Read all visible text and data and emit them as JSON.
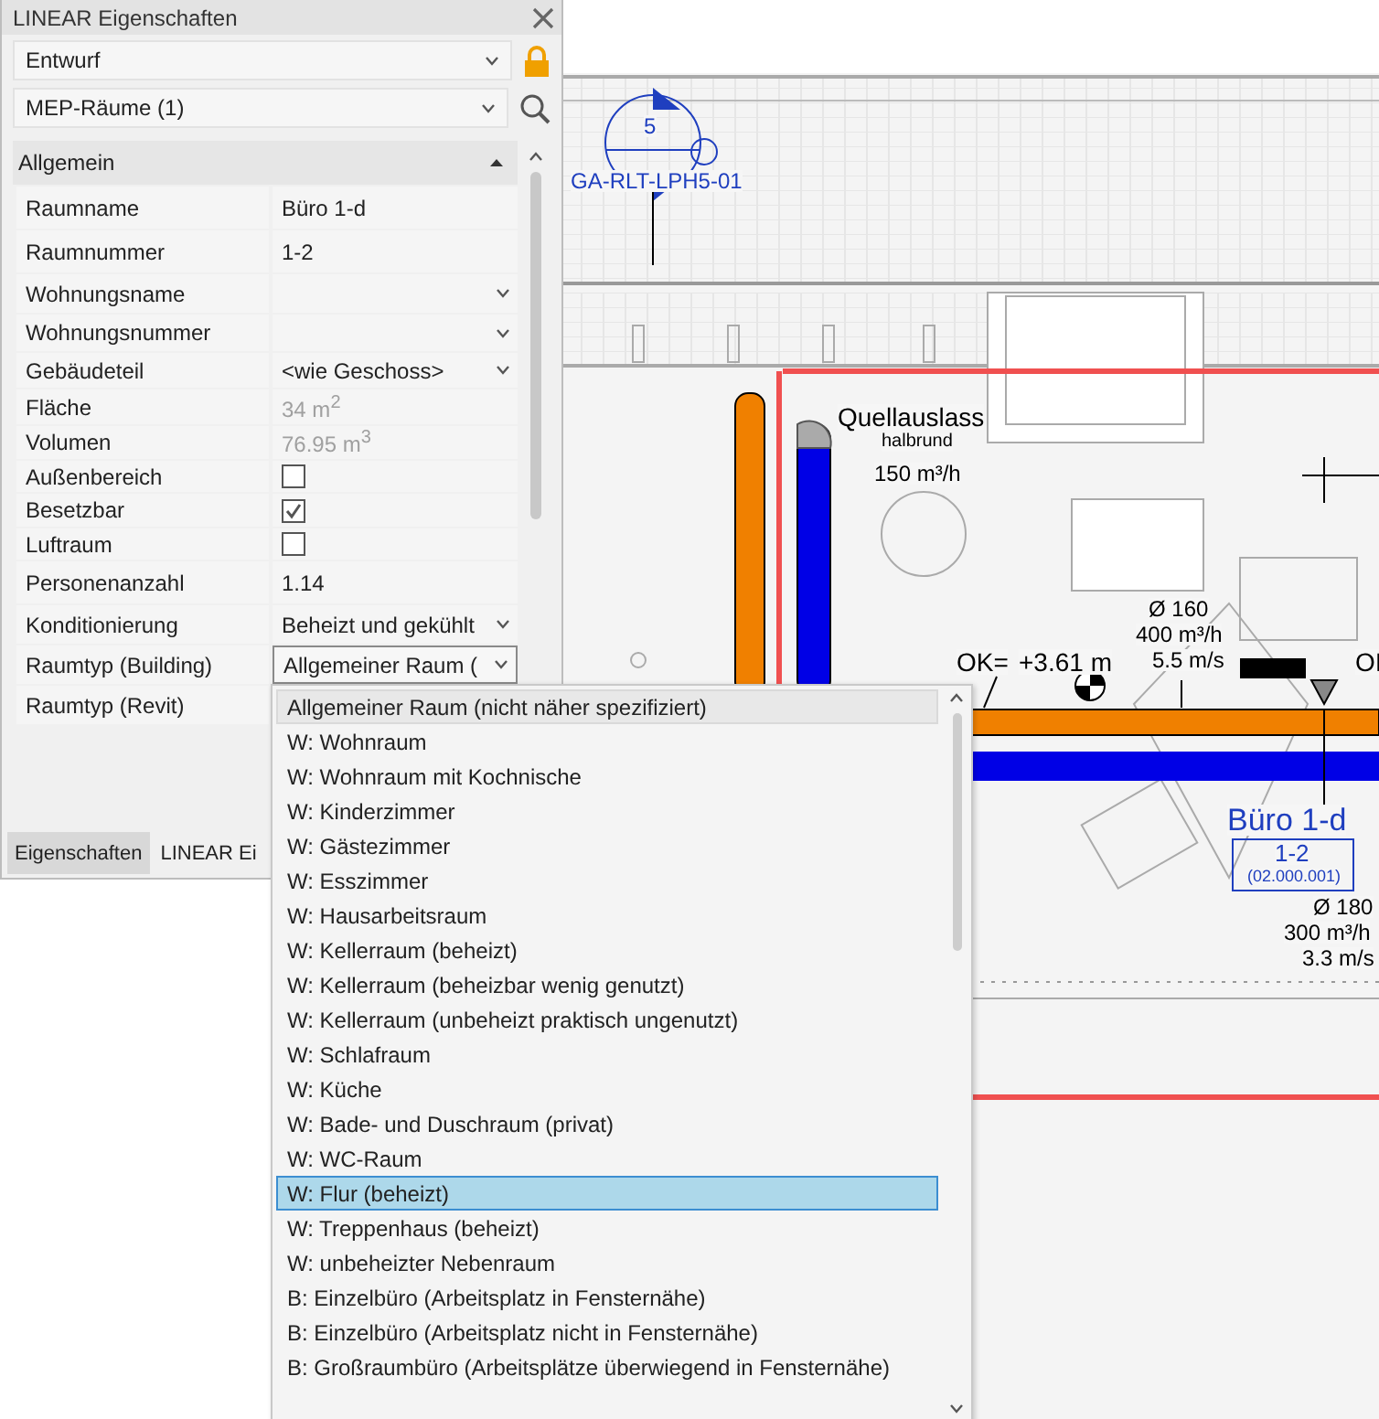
{
  "panel": {
    "title": "LINEAR Eigenschaften",
    "selectors": [
      {
        "value": "Entwurf",
        "kind": "lock"
      },
      {
        "value": "MEP-Räume (1)",
        "kind": "search"
      }
    ],
    "section": {
      "title": "Allgemein",
      "expanded": true
    },
    "properties": [
      {
        "label": "Raumname",
        "value": "Büro 1-d",
        "kind": "text"
      },
      {
        "label": "Raumnummer",
        "value": "1-2",
        "kind": "text"
      },
      {
        "label": "Wohnungsname",
        "kind": "select"
      },
      {
        "label": "Wohnungsnummer",
        "kind": "select"
      },
      {
        "label": "Gebäudeteil",
        "value": "<wie Geschoss>",
        "kind": "select"
      },
      {
        "label": "Fläche",
        "value": "34 m$^{2}$",
        "kind": "readonly"
      },
      {
        "label": "Volumen",
        "value": "76.95 m$^{3}$",
        "kind": "readonly"
      },
      {
        "label": "Außenbereich",
        "kind": "checkbox",
        "checked": false
      },
      {
        "label": "Besetzbar",
        "kind": "checkbox",
        "checked": true
      },
      {
        "label": "Luftraum",
        "kind": "checkbox",
        "checked": false
      },
      {
        "label": "Personenanzahl",
        "value": "1.14",
        "kind": "text"
      },
      {
        "label": "Konditionierung",
        "value": "Beheizt und gekühlt",
        "kind": "select"
      },
      {
        "label": "Raumtyp (Building)",
        "value": "Allgemeiner Raum (",
        "kind": "open-select"
      },
      {
        "label": "Raumtyp (Revit)",
        "kind": "text"
      }
    ],
    "tabs": [
      {
        "label": "Eigenschaften",
        "selected": true
      },
      {
        "label": "LINEAR Ei",
        "selected": false
      }
    ]
  },
  "dropdown": {
    "items": [
      {
        "label": "Allgemeiner Raum (nicht näher spezifiziert)",
        "selected": false,
        "highlighted": true
      },
      {
        "label": "W: Wohnraum",
        "selected": false,
        "highlighted": false
      },
      {
        "label": "W: Wohnraum mit Kochnische",
        "selected": false,
        "highlighted": false
      },
      {
        "label": "W: Kinderzimmer",
        "selected": false,
        "highlighted": false
      },
      {
        "label": "W: Gästezimmer",
        "selected": false,
        "highlighted": false
      },
      {
        "label": "W: Esszimmer",
        "selected": false,
        "highlighted": false
      },
      {
        "label": "W: Hausarbeitsraum",
        "selected": false,
        "highlighted": false
      },
      {
        "label": "W: Kellerraum (beheizt)",
        "selected": false,
        "highlighted": false
      },
      {
        "label": "W: Kellerraum (beheizbar wenig genutzt)",
        "selected": false,
        "highlighted": false
      },
      {
        "label": "W: Kellerraum (unbeheizt praktisch ungenutzt)",
        "selected": false,
        "highlighted": false
      },
      {
        "label": "W: Schlafraum",
        "selected": false,
        "highlighted": false
      },
      {
        "label": "W: Küche",
        "selected": false,
        "highlighted": false
      },
      {
        "label": "W: Bade- und Duschraum (privat)",
        "selected": false,
        "highlighted": false
      },
      {
        "label": "W: WC-Raum",
        "selected": false,
        "highlighted": false
      },
      {
        "label": "W: Flur (beheizt)",
        "selected": true,
        "highlighted": false
      },
      {
        "label": "W: Treppenhaus (beheizt)",
        "selected": false,
        "highlighted": false
      },
      {
        "label": "W: unbeheizter Nebenraum",
        "selected": false,
        "highlighted": false
      },
      {
        "label": "B: Einzelbüro (Arbeitsplatz in Fensternähe)",
        "selected": false,
        "highlighted": false
      },
      {
        "label": "B: Einzelbüro (Arbeitsplatz nicht in Fensternähe)",
        "selected": false,
        "highlighted": false
      },
      {
        "label": "B: Großraumbüro (Arbeitsplätze überwiegend in Fensternähe)",
        "selected": false,
        "highlighted": false
      }
    ]
  },
  "drawing": {
    "labels": [
      {
        "text": "5",
        "kind": "tag"
      },
      {
        "text": "GA-RLT-LPH5-01",
        "kind": "tag"
      },
      {
        "text": "Quellauslass",
        "kind": "large"
      },
      {
        "text": "halbrund",
        "kind": "small"
      },
      {
        "text": "150 m³/h",
        "kind": "normal"
      },
      {
        "text": "Ø 160",
        "kind": "normal"
      },
      {
        "text": "400 m³/h",
        "kind": "normal"
      },
      {
        "text": "OK=",
        "kind": "large"
      },
      {
        "text": "+3.61 m",
        "kind": "large"
      },
      {
        "text": "5.5 m/s",
        "kind": "normal"
      },
      {
        "text": "OI",
        "kind": "large"
      },
      {
        "text": "Büro 1-d",
        "kind": "room"
      },
      {
        "text": "1-2",
        "kind": "roomnum"
      },
      {
        "text": "(02.000.001)",
        "kind": "roomcode"
      },
      {
        "text": "Ø 180",
        "kind": "normal"
      },
      {
        "text": "300 m³/h",
        "kind": "normal"
      },
      {
        "text": "3.3 m/s",
        "kind": "normal"
      }
    ]
  }
}
